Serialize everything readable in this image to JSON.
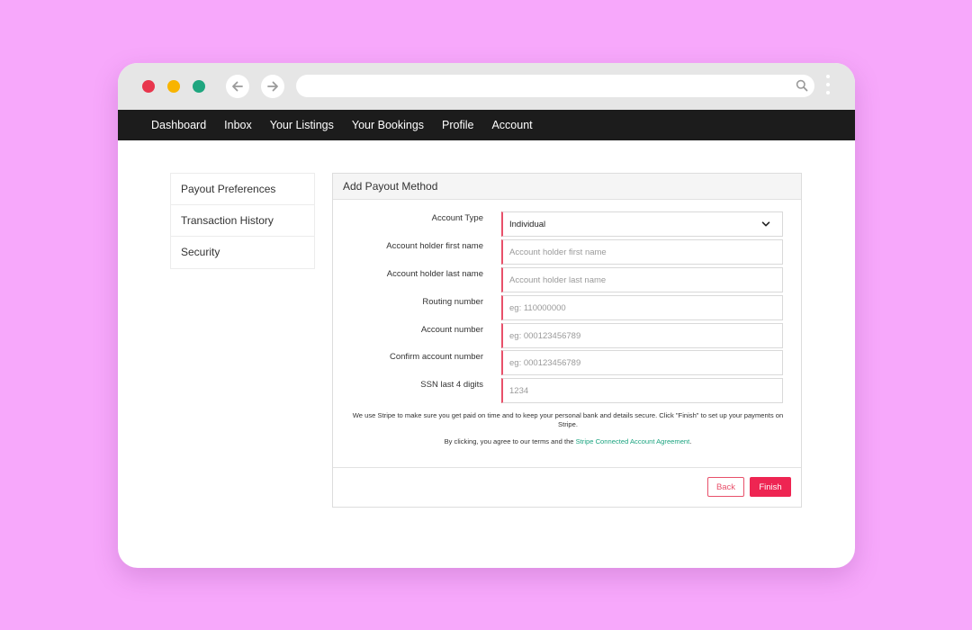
{
  "browser": {
    "colors": {
      "close": "#e8364d",
      "minimize": "#f8b400",
      "maximize": "#1fa67f"
    },
    "icons": {
      "back": "arrow-left-icon",
      "forward": "arrow-right-icon",
      "search": "search-icon",
      "menu": "more-vertical-icon"
    }
  },
  "nav": {
    "items": [
      {
        "label": "Dashboard"
      },
      {
        "label": "Inbox"
      },
      {
        "label": "Your Listings"
      },
      {
        "label": "Your Bookings"
      },
      {
        "label": "Profile"
      },
      {
        "label": "Account"
      }
    ]
  },
  "sidebar": {
    "items": [
      {
        "label": "Payout Preferences"
      },
      {
        "label": "Transaction History"
      },
      {
        "label": "Security"
      }
    ]
  },
  "panel": {
    "title": "Add Payout Method",
    "account_type": {
      "label": "Account Type",
      "value": "Individual"
    },
    "fields": [
      {
        "label": "Account holder first name",
        "placeholder": "Account holder first name"
      },
      {
        "label": "Account holder last name",
        "placeholder": "Account holder last name"
      },
      {
        "label": "Routing number",
        "placeholder": "eg: 110000000"
      },
      {
        "label": "Account number",
        "placeholder": "eg: 000123456789"
      },
      {
        "label": "Confirm account number",
        "placeholder": "eg: 000123456789"
      },
      {
        "label": "SSN last 4 digits",
        "placeholder": "1234"
      }
    ],
    "note": "We use Stripe to make sure you get paid on time and to keep your personal bank and details secure. Click \"Finish\" to set up your payments on Stripe.",
    "agree_prefix": "By clicking, you agree to our terms and the ",
    "agree_link": "Stripe Connected Account Agreement",
    "agree_suffix": ".",
    "back_label": "Back",
    "finish_label": "Finish",
    "accent": "#ee2552",
    "link_color": "#1aa37f"
  }
}
